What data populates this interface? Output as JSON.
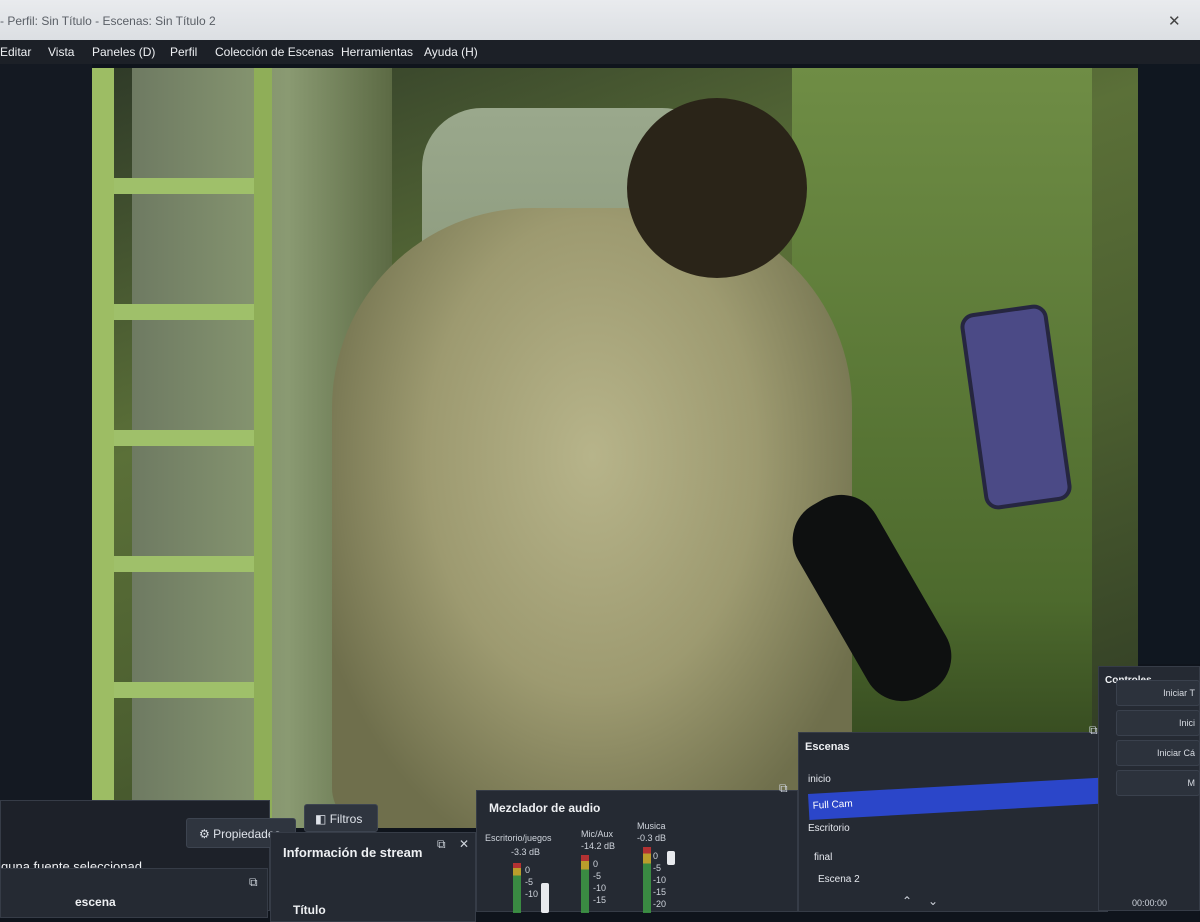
{
  "window": {
    "title": "- Perfil: Sin Título - Escenas: Sin Título 2"
  },
  "menu": {
    "items": [
      "Editar",
      "Vista",
      "Paneles (D)",
      "Perfil",
      "Colección de Escenas",
      "Herramientas",
      "Ayuda (H)"
    ]
  },
  "source_toolbar": {
    "no_source_text": "guna fuente seleccionad",
    "properties_label": "Propiedades",
    "filters_label": "Filtros"
  },
  "stream_info": {
    "header": "Información de stream",
    "title_label": "Título"
  },
  "scenes_panel": {
    "header_partial": "escena"
  },
  "audio_mixer": {
    "header": "Mezclador de audio",
    "channels": [
      {
        "name": "Escritorio/juegos",
        "db": "-3.3 dB"
      },
      {
        "name": "Mic/Aux",
        "db": "-14.2 dB"
      },
      {
        "name": "Musica",
        "db": "-0.3 dB"
      }
    ],
    "scale": [
      "0",
      "-5",
      "-10",
      "-15",
      "-20"
    ]
  },
  "scenes": {
    "header": "Escenas",
    "items": [
      {
        "label": "inicio",
        "selected": false
      },
      {
        "label": "Full Cam",
        "selected": true
      },
      {
        "label": "Escritorio",
        "selected": false
      },
      {
        "label": "final",
        "selected": false
      },
      {
        "label": "Escena 2",
        "selected": false
      }
    ]
  },
  "controls": {
    "header": "Controles",
    "buttons": [
      "Iniciar T",
      "Inici",
      "Iniciar Cá",
      "M"
    ],
    "timer": "00:00:00"
  },
  "colors": {
    "selected_scene": "#2b46c9",
    "panel_bg": "#252a33",
    "menubar_bg": "#1c2027"
  }
}
